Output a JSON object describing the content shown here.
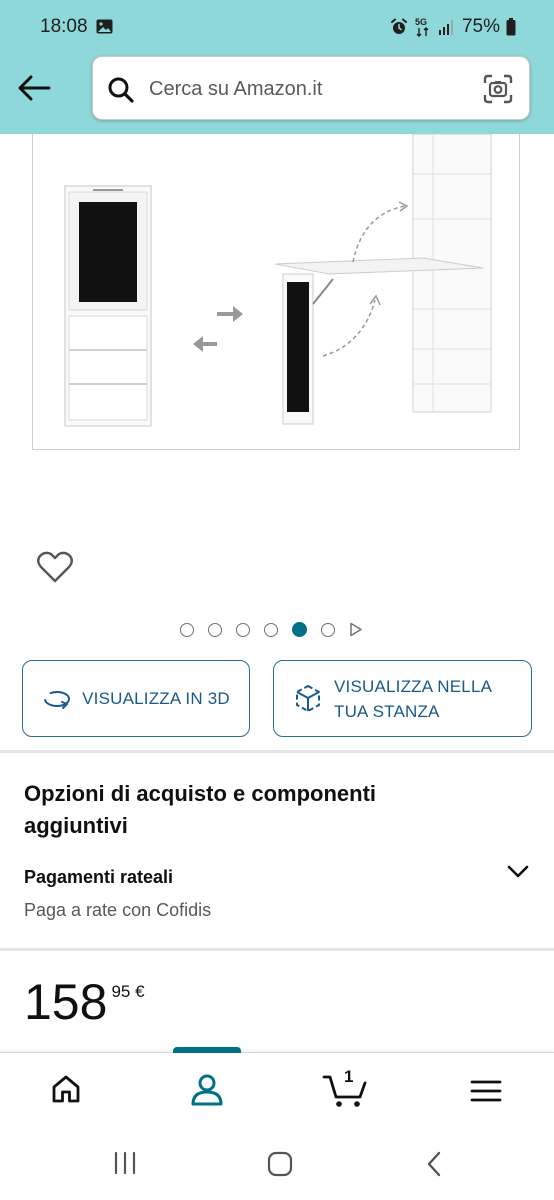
{
  "status_bar": {
    "time": "18:08",
    "battery": "75%",
    "network": "5G"
  },
  "search": {
    "placeholder": "Cerca su Amazon.it"
  },
  "carousel": {
    "count": 6,
    "active_index": 4
  },
  "buttons": {
    "view_3d": "VISUALIZZA IN 3D",
    "view_room_line1": "VISUALIZZA NELLA",
    "view_room_line2": "TUA STANZA"
  },
  "options": {
    "title": "Opzioni di acquisto e componenti aggiuntivi",
    "installment_title": "Pagamenti rateali",
    "installment_sub": "Paga a rate con Cofidis"
  },
  "price": {
    "whole": "158",
    "fraction": "95 €"
  },
  "bottom_nav": {
    "cart_count": "1",
    "active": "account"
  },
  "colors": {
    "header_bg": "#8fd8da",
    "accent": "#007185",
    "button_border": "#2a6e8f"
  }
}
